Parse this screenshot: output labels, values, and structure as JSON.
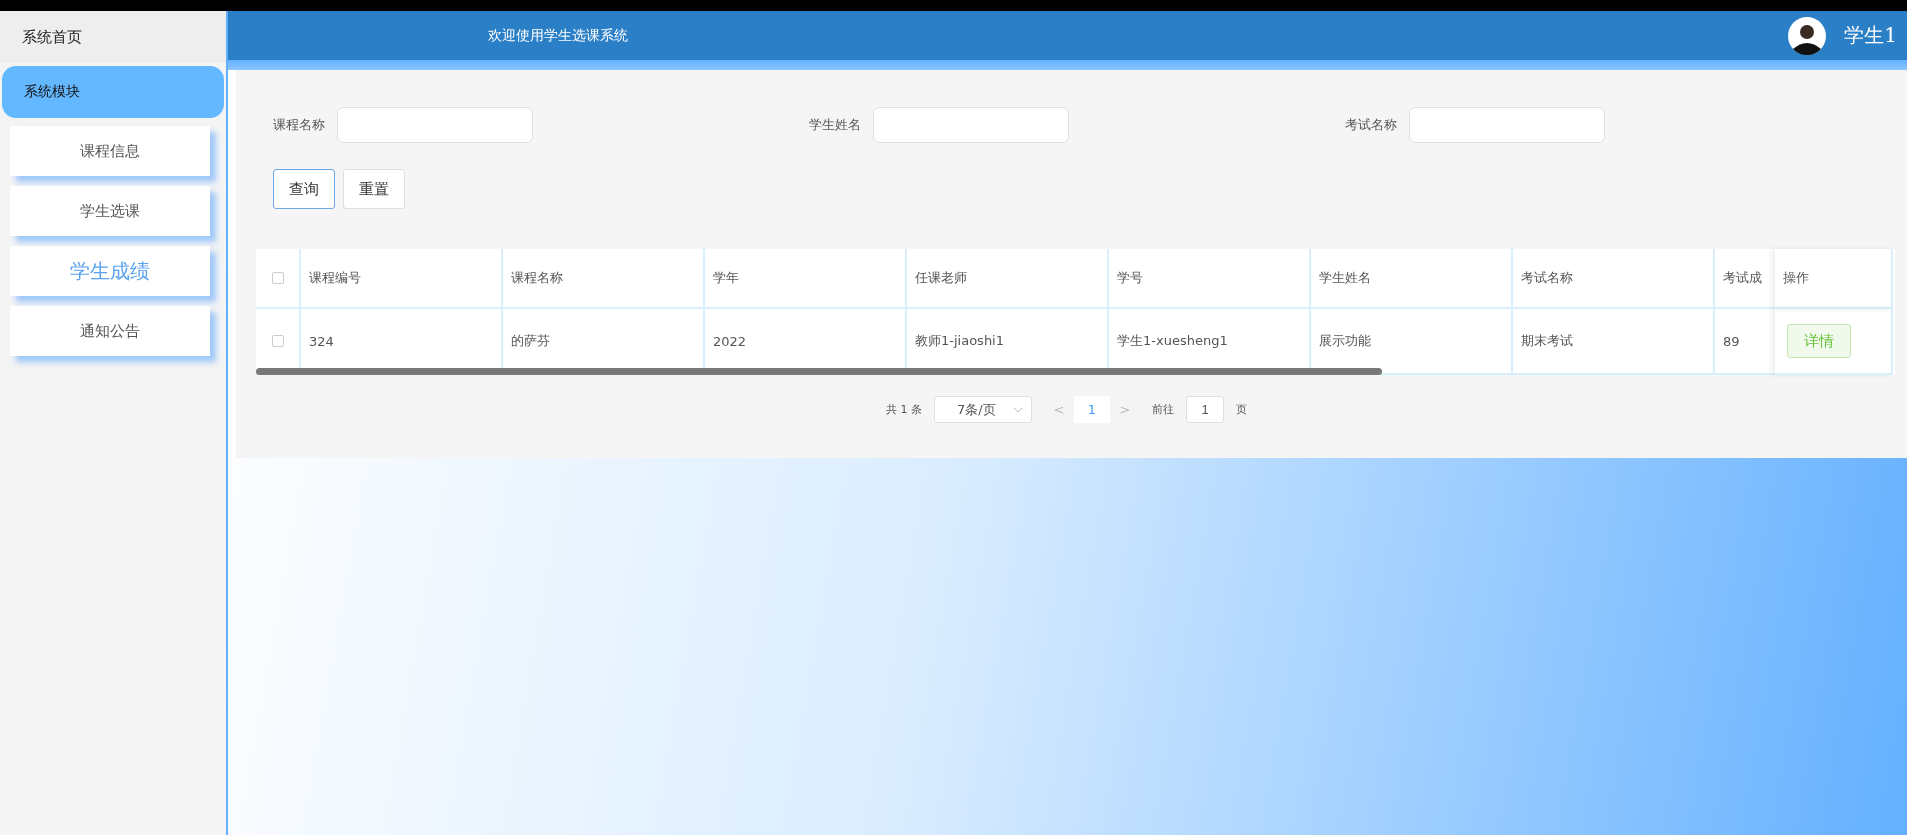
{
  "sidebar": {
    "home": "系统首页",
    "module": "系统模块",
    "items": [
      {
        "label": "课程信息",
        "selected": false
      },
      {
        "label": "学生选课",
        "selected": false
      },
      {
        "label": "学生成绩",
        "selected": true
      },
      {
        "label": "通知公告",
        "selected": false
      }
    ]
  },
  "header": {
    "title": "欢迎使用学生选课系统",
    "user": "学生1"
  },
  "search": {
    "fields": [
      {
        "label": "课程名称"
      },
      {
        "label": "学生姓名"
      },
      {
        "label": "考试名称"
      }
    ],
    "buttons": [
      {
        "label": "查询",
        "kind": "primary"
      },
      {
        "label": "重置",
        "kind": "plain"
      }
    ]
  },
  "table": {
    "select_all_checked": false,
    "columns": [
      "课程编号",
      "课程名称",
      "学年",
      "任课老师",
      "学号",
      "学生姓名",
      "考试名称",
      "考试成"
    ],
    "action_column": "操作",
    "rows": [
      {
        "checked": false,
        "cells": [
          "324",
          "的萨芬",
          "2022",
          "教师1-jiaoshi1",
          "学生1-xuesheng1",
          "展示功能",
          "期末考试",
          "89"
        ],
        "action": "详情"
      }
    ]
  },
  "pagination": {
    "total": "共 1 条",
    "page_size": "7条/页",
    "prev": "<",
    "pages": [
      {
        "label": "1",
        "selected": true
      }
    ],
    "next": ">",
    "goto_label": "前往",
    "goto_value": "1",
    "goto_unit": "页"
  }
}
